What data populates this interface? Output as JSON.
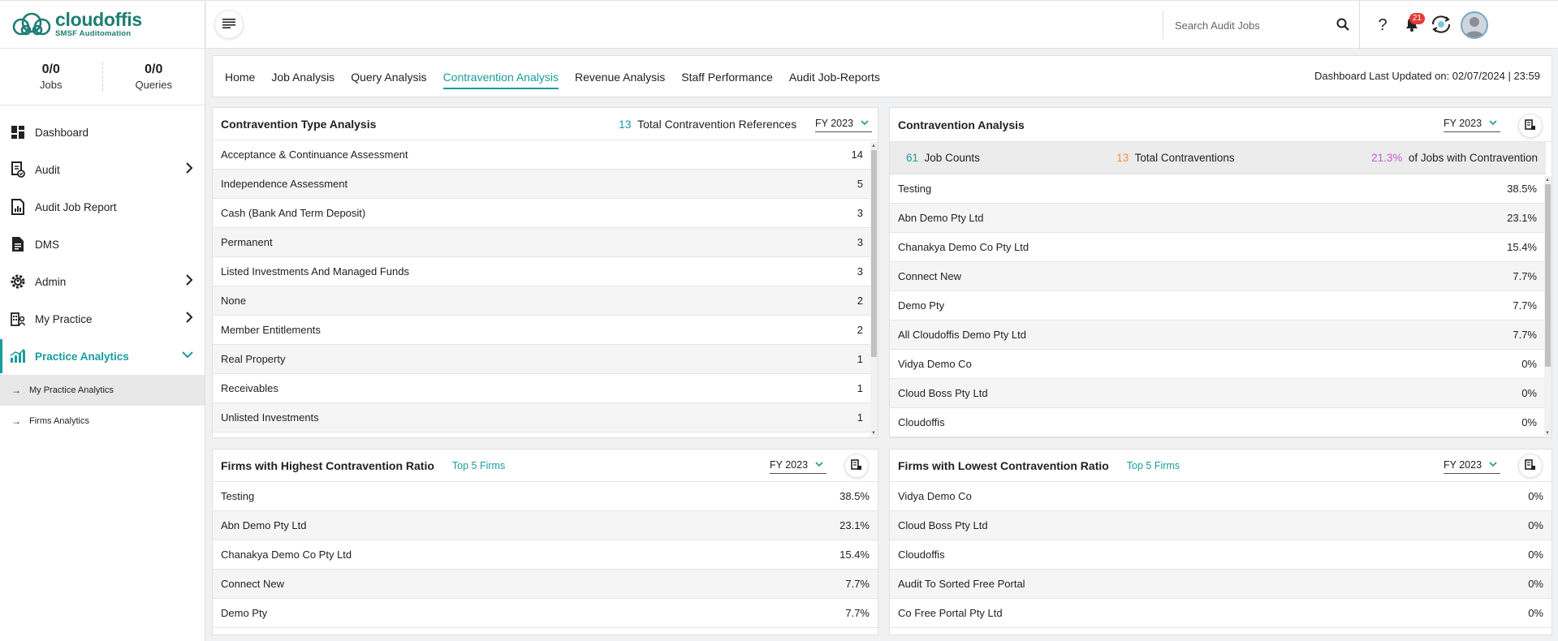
{
  "brand": {
    "name": "cloudoffis",
    "tagline": "SMSF Auditomation",
    "color": "#1e7d74"
  },
  "counters": [
    {
      "value": "0/0",
      "label": "Jobs"
    },
    {
      "value": "0/0",
      "label": "Queries"
    }
  ],
  "nav": {
    "dashboard": "Dashboard",
    "audit": "Audit",
    "audit_job_report": "Audit Job Report",
    "dms": "DMS",
    "admin": "Admin",
    "my_practice": "My Practice",
    "practice_analytics": "Practice Analytics",
    "sub_my_practice_analytics": "My Practice Analytics",
    "sub_firms_analytics": "Firms Analytics"
  },
  "search": {
    "placeholder": "Search Audit Jobs"
  },
  "notifications": {
    "count": "21"
  },
  "tabs": [
    "Home",
    "Job Analysis",
    "Query Analysis",
    "Contravention Analysis",
    "Revenue Analysis",
    "Staff Performance",
    "Audit Job-Reports"
  ],
  "active_tab": "Contravention Analysis",
  "last_updated": "Dashboard Last Updated on: 02/07/2024 | 23:59",
  "accent_color": "#1a9c9c",
  "type_analysis": {
    "title": "Contravention Type Analysis",
    "total_num": "13",
    "total_label": "Total Contravention References",
    "fy": "FY 2023",
    "rows": [
      {
        "name": "Acceptance & Continuance Assessment",
        "value": "14"
      },
      {
        "name": "Independence Assessment",
        "value": "5"
      },
      {
        "name": "Cash (Bank And Term Deposit)",
        "value": "3"
      },
      {
        "name": "Permanent",
        "value": "3"
      },
      {
        "name": "Listed Investments And Managed Funds",
        "value": "3"
      },
      {
        "name": "None",
        "value": "2"
      },
      {
        "name": "Member Entitlements",
        "value": "2"
      },
      {
        "name": "Real Property",
        "value": "1"
      },
      {
        "name": "Receivables",
        "value": "1"
      },
      {
        "name": "Unlisted Investments",
        "value": "1"
      }
    ]
  },
  "contravention_analysis": {
    "title": "Contravention Analysis",
    "fy": "FY 2023",
    "job_counts_num": "61",
    "job_counts_label": "Job Counts",
    "total_num": "13",
    "total_label": "Total Contraventions",
    "pct_num": "21.3%",
    "pct_label": "of Jobs with Contravention",
    "rows": [
      {
        "name": "Testing",
        "value": "38.5%"
      },
      {
        "name": "Abn Demo Pty Ltd",
        "value": "23.1%"
      },
      {
        "name": "Chanakya Demo Co Pty Ltd",
        "value": "15.4%"
      },
      {
        "name": "Connect New",
        "value": "7.7%"
      },
      {
        "name": "Demo Pty",
        "value": "7.7%"
      },
      {
        "name": "All Cloudoffis Demo Pty Ltd",
        "value": "7.7%"
      },
      {
        "name": "Vidya Demo Co",
        "value": "0%"
      },
      {
        "name": "Cloud Boss Pty Ltd",
        "value": "0%"
      },
      {
        "name": "Cloudoffis",
        "value": "0%"
      }
    ]
  },
  "highest": {
    "title": "Firms with Highest Contravention Ratio",
    "top5": "Top 5 Firms",
    "fy": "FY 2023",
    "rows": [
      {
        "name": "Testing",
        "value": "38.5%"
      },
      {
        "name": "Abn Demo Pty Ltd",
        "value": "23.1%"
      },
      {
        "name": "Chanakya Demo Co Pty Ltd",
        "value": "15.4%"
      },
      {
        "name": "Connect New",
        "value": "7.7%"
      },
      {
        "name": "Demo Pty",
        "value": "7.7%"
      }
    ]
  },
  "lowest": {
    "title": "Firms with Lowest Contravention Ratio",
    "top5": "Top 5 Firms",
    "fy": "FY 2023",
    "rows": [
      {
        "name": "Vidya Demo Co",
        "value": "0%"
      },
      {
        "name": "Cloud Boss Pty Ltd",
        "value": "0%"
      },
      {
        "name": "Cloudoffis",
        "value": "0%"
      },
      {
        "name": "Audit To Sorted Free Portal",
        "value": "0%"
      },
      {
        "name": "Co Free Portal Pty Ltd",
        "value": "0%"
      }
    ]
  }
}
